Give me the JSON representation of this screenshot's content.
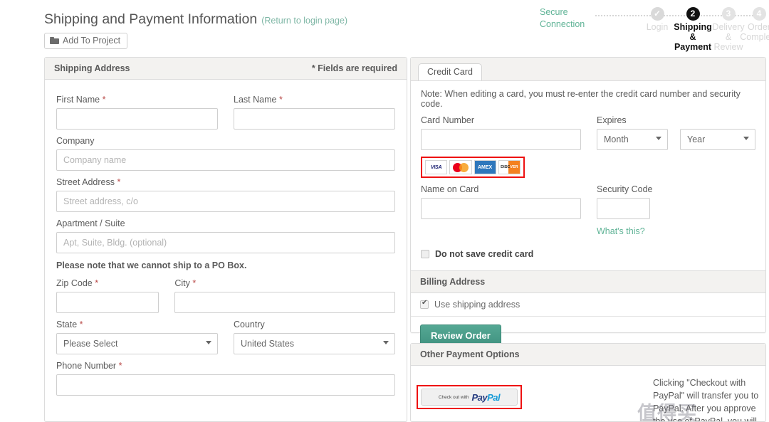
{
  "header": {
    "title": "Shipping and Payment Information",
    "return_link": "(Return to login page)",
    "add_to_project": "Add To Project",
    "folder_icon": "folder-icon"
  },
  "progress": {
    "secure_line1": "Secure",
    "secure_line2": "Connection",
    "steps": [
      {
        "bubble": "✓",
        "caption": "Login",
        "state": "done"
      },
      {
        "bubble": "2",
        "caption": "Shipping\n&\nPayment",
        "state": "current"
      },
      {
        "bubble": "3",
        "caption": "Delivery\n&\nReview",
        "state": "todo"
      },
      {
        "bubble": "4",
        "caption": "Order\nComplete",
        "state": "todo"
      }
    ]
  },
  "shipping": {
    "panel_title": "Shipping Address",
    "required_note": "* Fields are required",
    "first_name_label": "First Name",
    "first_name_value": "",
    "last_name_label": "Last Name",
    "last_name_value": "",
    "company_label": "Company",
    "company_placeholder": "Company name",
    "street_label": "Street Address",
    "street_placeholder": "Street address, c/o",
    "apartment_label": "Apartment / Suite",
    "apartment_placeholder": "Apt, Suite, Bldg. (optional)",
    "po_box_note": "Please note that we cannot ship to a PO Box.",
    "zip_label": "Zip Code",
    "zip_value": "",
    "city_label": "City",
    "city_value": "",
    "state_label": "State",
    "state_value": "Please Select",
    "country_label": "Country",
    "country_value": "United States",
    "phone_label": "Phone Number",
    "phone_value": "",
    "required_star": "*"
  },
  "credit_card": {
    "tab_label": "Credit Card",
    "note": "Note: When editing a card, you must re-enter the credit card number and security code.",
    "card_number_label": "Card Number",
    "card_number_value": "",
    "expires_label": "Expires",
    "month_value": "Month",
    "year_value": "Year",
    "brands": [
      "VISA",
      "mastercard",
      "AMEX",
      "DISCOVER"
    ],
    "name_on_card_label": "Name on Card",
    "name_on_card_value": "",
    "security_code_label": "Security Code",
    "security_code_value": "",
    "whats_this": "What's this?",
    "do_not_save_label": "Do not save credit card",
    "do_not_save_checked": false,
    "billing_title": "Billing Address",
    "use_shipping_label": "Use shipping address",
    "use_shipping_checked": true,
    "review_order": "Review Order"
  },
  "other_payment": {
    "panel_title": "Other Payment Options",
    "paypal_prefix": "Check out with",
    "paypal_pay": "Pay",
    "paypal_pal": "Pal",
    "description": "Clicking \"Checkout with PayPal\" will transfer you to PayPal. After you approve the use of PayPal, you will",
    "watermark": "值得买"
  },
  "colors": {
    "accent_green": "#5fb396",
    "button_green": "#409280",
    "required_red": "#b94a48",
    "annotation_red": "#ee1111",
    "panel_head": "#f3f2f0",
    "border": "#dcdcdc"
  }
}
